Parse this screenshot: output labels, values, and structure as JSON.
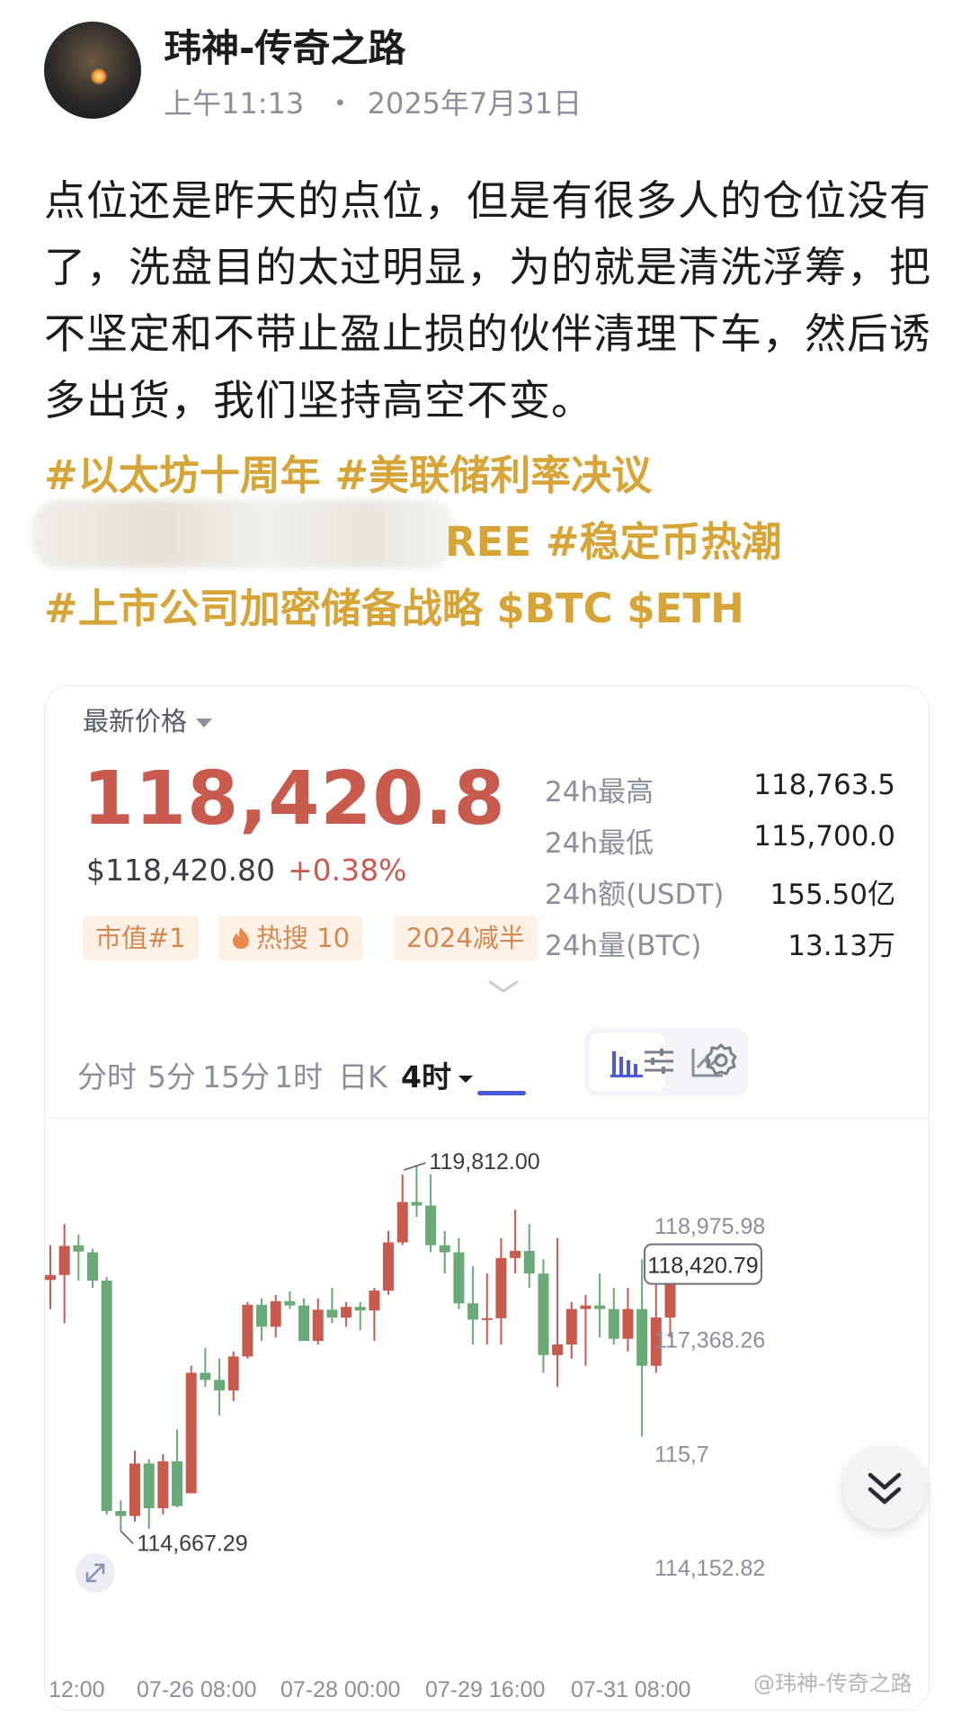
{
  "header": {
    "author": "玮神-传奇之路",
    "time": "上午11:13",
    "separator": "・",
    "date": "2025年7月31日"
  },
  "post": {
    "text": "点位还是昨天的点位，但是有很多人的仓位没有了，洗盘目的太过明显，为的就是清洗浮筹，把不坚定和不带止盈止损的伙伴清理下车，然后诱多出货，我们坚持高空不变。",
    "tags_line1": "#以太坊十周年 #美联储利率决议",
    "tags_line2_visible": "REE #稳定币热潮",
    "tags_line3": "#上市公司加密储备战略 $BTC $ETH"
  },
  "ticker": {
    "latest_label": "最新价格",
    "price": "118,420.8",
    "usd_price": "$118,420.80",
    "change": "+0.38%",
    "badges": [
      "市值#1",
      "热搜 10",
      "2024减半"
    ],
    "stats": [
      {
        "label": "24h最高",
        "value": "118,763.5"
      },
      {
        "label": "24h最低",
        "value": "115,700.0"
      },
      {
        "label": "24h额(USDT)",
        "value": "155.50亿"
      },
      {
        "label": "24h量(BTC)",
        "value": "13.13万"
      }
    ]
  },
  "tabs": [
    "分时",
    "5分",
    "15分",
    "1时",
    "日K",
    "4时"
  ],
  "active_tab": "4时",
  "colors": {
    "up": "#c85a4e",
    "down": "#6aaa78",
    "accent": "#4b58d8",
    "tag": "#d7a537"
  },
  "icons": [
    "candlestick-chart-icon",
    "line-chart-icon",
    "indicator-settings-icon",
    "gear-icon",
    "fullscreen-icon",
    "scroll-down-icon"
  ],
  "chart_data": {
    "type": "candlestick",
    "y_ticks": [
      "118,975.98",
      "117,368.26",
      "115,7",
      "114,152.82"
    ],
    "x_ticks": [
      "12:00",
      "07-26 08:00",
      "07-28 00:00",
      "07-29 16:00",
      "07-31 08:00"
    ],
    "current_price_label": "118,420.79",
    "high_annotation": "119,812.00",
    "low_annotation": "114,667.29",
    "ylim": [
      114152.82,
      119812.0
    ],
    "candles": [
      {
        "o": 118210,
        "h": 118700,
        "l": 117800,
        "c": 118280
      },
      {
        "o": 118280,
        "h": 119000,
        "l": 117600,
        "c": 118690
      },
      {
        "o": 118700,
        "h": 118850,
        "l": 118200,
        "c": 118610
      },
      {
        "o": 118600,
        "h": 118650,
        "l": 118100,
        "c": 118200
      },
      {
        "o": 118200,
        "h": 118250,
        "l": 114900,
        "c": 114950
      },
      {
        "o": 114950,
        "h": 115100,
        "l": 114667.29,
        "c": 114880
      },
      {
        "o": 114880,
        "h": 115800,
        "l": 114800,
        "c": 115620
      },
      {
        "o": 115620,
        "h": 115680,
        "l": 114700,
        "c": 114990
      },
      {
        "o": 114990,
        "h": 115750,
        "l": 114900,
        "c": 115650
      },
      {
        "o": 115650,
        "h": 116100,
        "l": 115000,
        "c": 115020
      },
      {
        "o": 115200,
        "h": 117000,
        "l": 115200,
        "c": 116900
      },
      {
        "o": 116900,
        "h": 117250,
        "l": 116700,
        "c": 116800
      },
      {
        "o": 116800,
        "h": 117100,
        "l": 116300,
        "c": 116650
      },
      {
        "o": 116650,
        "h": 117200,
        "l": 116500,
        "c": 117130
      },
      {
        "o": 117130,
        "h": 117900,
        "l": 117100,
        "c": 117860
      },
      {
        "o": 117860,
        "h": 117950,
        "l": 117350,
        "c": 117550
      },
      {
        "o": 117550,
        "h": 118000,
        "l": 117400,
        "c": 117910
      },
      {
        "o": 117910,
        "h": 118050,
        "l": 117800,
        "c": 117850
      },
      {
        "o": 117850,
        "h": 117950,
        "l": 117400,
        "c": 117350
      },
      {
        "o": 117350,
        "h": 117950,
        "l": 117300,
        "c": 117790
      },
      {
        "o": 117790,
        "h": 118100,
        "l": 117600,
        "c": 117680
      },
      {
        "o": 117680,
        "h": 117900,
        "l": 117550,
        "c": 117830
      },
      {
        "o": 117830,
        "h": 117900,
        "l": 117500,
        "c": 117780
      },
      {
        "o": 117780,
        "h": 118100,
        "l": 117350,
        "c": 118060
      },
      {
        "o": 118060,
        "h": 118900,
        "l": 118000,
        "c": 118740
      },
      {
        "o": 118740,
        "h": 119700,
        "l": 118700,
        "c": 119310
      },
      {
        "o": 119310,
        "h": 119812,
        "l": 119100,
        "c": 119260
      },
      {
        "o": 119260,
        "h": 119700,
        "l": 118600,
        "c": 118700
      },
      {
        "o": 118700,
        "h": 118900,
        "l": 118300,
        "c": 118600
      },
      {
        "o": 118600,
        "h": 118800,
        "l": 117800,
        "c": 117880
      },
      {
        "o": 117880,
        "h": 118400,
        "l": 117300,
        "c": 117650
      },
      {
        "o": 117650,
        "h": 118300,
        "l": 117300,
        "c": 117670
      },
      {
        "o": 117670,
        "h": 118800,
        "l": 117300,
        "c": 118520
      },
      {
        "o": 118520,
        "h": 119200,
        "l": 118300,
        "c": 118620
      },
      {
        "o": 118620,
        "h": 119000,
        "l": 118100,
        "c": 118300
      },
      {
        "o": 118300,
        "h": 118500,
        "l": 116900,
        "c": 117150
      },
      {
        "o": 117150,
        "h": 118800,
        "l": 116700,
        "c": 117300
      },
      {
        "o": 117300,
        "h": 117900,
        "l": 117100,
        "c": 117800
      },
      {
        "o": 117800,
        "h": 118000,
        "l": 117000,
        "c": 117850
      },
      {
        "o": 117850,
        "h": 118300,
        "l": 117400,
        "c": 117800
      },
      {
        "o": 117800,
        "h": 118100,
        "l": 117300,
        "c": 117380
      },
      {
        "o": 117380,
        "h": 118100,
        "l": 117200,
        "c": 117800
      },
      {
        "o": 117800,
        "h": 118500,
        "l": 116000,
        "c": 117000
      },
      {
        "o": 117000,
        "h": 118300,
        "l": 116900,
        "c": 117680
      },
      {
        "o": 117680,
        "h": 118400,
        "l": 117400,
        "c": 118420.79
      }
    ]
  }
}
